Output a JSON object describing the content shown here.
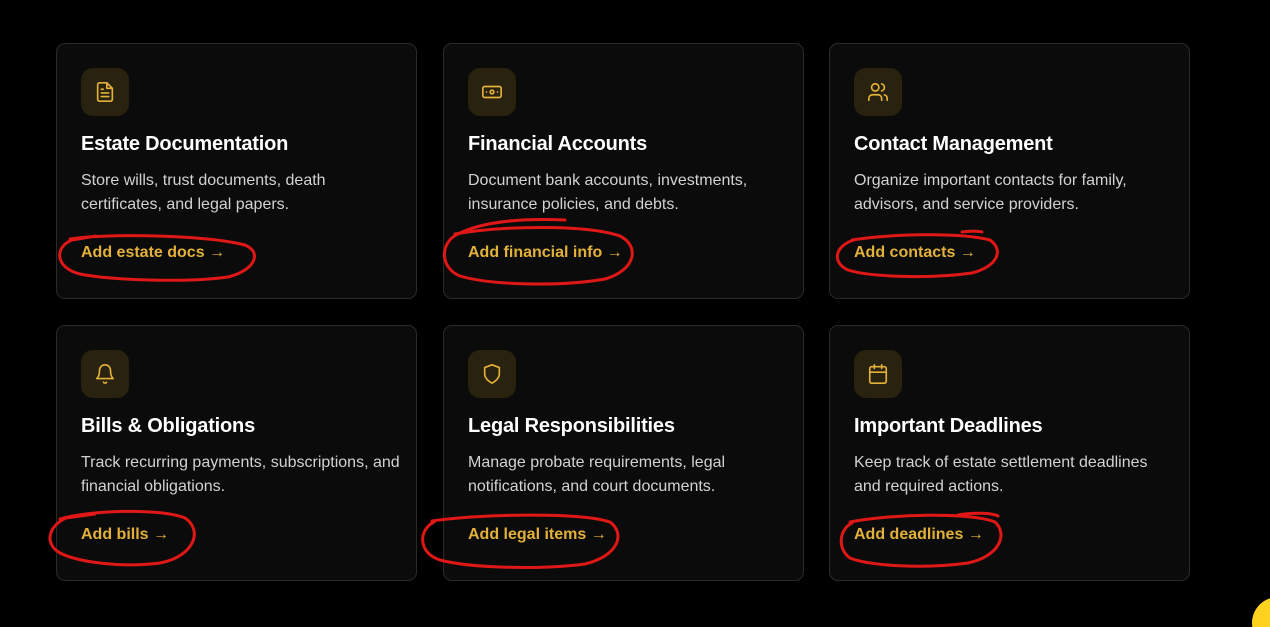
{
  "cards": [
    {
      "icon": "document-icon",
      "title": "Estate Documentation",
      "description": "Store wills, trust documents, death certificates, and legal papers.",
      "link": "Add estate docs →"
    },
    {
      "icon": "banknote-icon",
      "title": "Financial Accounts",
      "description": "Document bank accounts, investments, insurance policies, and debts.",
      "link": "Add financial info →"
    },
    {
      "icon": "users-icon",
      "title": "Contact Management",
      "description": "Organize important contacts for family, advisors, and service providers.",
      "link": "Add contacts →"
    },
    {
      "icon": "bell-icon",
      "title": "Bills & Obligations",
      "description": "Track recurring payments, subscriptions, and financial obligations.",
      "link": "Add bills →"
    },
    {
      "icon": "shield-icon",
      "title": "Legal Responsibilities",
      "description": "Manage probate requirements, legal notifications, and court documents.",
      "link": "Add legal items →"
    },
    {
      "icon": "calendar-icon",
      "title": "Important Deadlines",
      "description": "Keep track of estate settlement deadlines and required actions.",
      "link": "Add deadlines →"
    }
  ],
  "colors": {
    "background": "#000000",
    "card": "#0b0b0b",
    "accent": "#e3b13a",
    "annotation": "#e01717",
    "widget": "#ffd21f"
  }
}
